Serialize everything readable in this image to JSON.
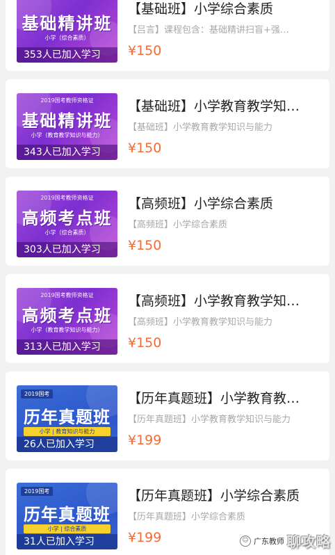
{
  "courses": [
    {
      "thumb": {
        "top": "",
        "big": "基础精讲班",
        "sub": "小学（综合素质）",
        "joined": "353人已加入学习"
      },
      "title": "【基础班】小学综合素质",
      "desc": "【吕言】课程包含：基础精讲扫盲+强…",
      "price": "¥150"
    },
    {
      "thumb": {
        "top": "2019国考教师资格证",
        "big": "基础精讲班",
        "sub": "小学（教育教学知识与能力）",
        "joined": "343人已加入学习"
      },
      "title": "【基础班】小学教育教学知…",
      "desc": "【基础班】小学教育教学知识与能力",
      "price": "¥150"
    },
    {
      "thumb": {
        "top": "2019国考教师资格证",
        "big": "高频考点班",
        "sub": "小学（综合素质）",
        "joined": "303人已加入学习"
      },
      "title": "【高频班】小学综合素质",
      "desc": "【高频班】小学综合素质",
      "price": "¥150"
    },
    {
      "thumb": {
        "top": "2019国考教师资格证",
        "big": "高频考点班",
        "sub": "小学（教育教学知识与能力）",
        "joined": "313人已加入学习"
      },
      "title": "【高频班】小学教育教学知…",
      "desc": "【高频班】小学教育教学知识与能力",
      "price": "¥150"
    },
    {
      "thumb": {
        "year": "2019国考",
        "big": "历年真题班",
        "bar": "小学 | 教育知识与能力",
        "joined": "26人已加入学习"
      },
      "title": "【历年真题班】小学教育教…",
      "desc": "【历年真题班】小学教育教学知识与能力",
      "price": "¥199"
    },
    {
      "thumb": {
        "year": "2019国考",
        "big": "历年真题班",
        "bar": "小学 | 综合素质",
        "joined": "31人已加入学习"
      },
      "title": "【历年真题班】小学综合素质",
      "desc": "【历年真题班】小学综合素质",
      "price": "¥199"
    }
  ],
  "watermark": {
    "icon": "wechat-icon",
    "text": "广东教师",
    "brand": "聊攻略"
  }
}
